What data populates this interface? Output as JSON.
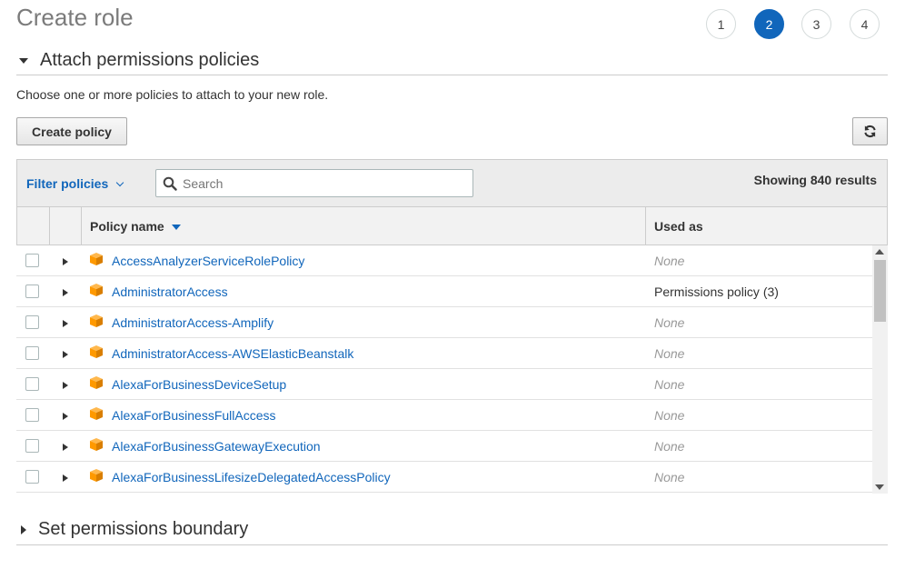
{
  "page": {
    "title": "Create role"
  },
  "steps": [
    "1",
    "2",
    "3",
    "4"
  ],
  "active_step": "2",
  "attach": {
    "heading": "Attach permissions policies",
    "description": "Choose one or more policies to attach to your new role.",
    "create_policy_label": "Create policy",
    "refresh_icon": "refresh-icon"
  },
  "filter": {
    "label": "Filter policies",
    "search_placeholder": "Search",
    "showing": "Showing 840 results"
  },
  "table": {
    "columns": {
      "name": "Policy name",
      "used": "Used as"
    },
    "rows": [
      {
        "name": "AccessAnalyzerServiceRolePolicy",
        "used": "None"
      },
      {
        "name": "AdministratorAccess",
        "used": "Permissions policy (3)"
      },
      {
        "name": "AdministratorAccess-Amplify",
        "used": "None"
      },
      {
        "name": "AdministratorAccess-AWSElasticBeanstalk",
        "used": "None"
      },
      {
        "name": "AlexaForBusinessDeviceSetup",
        "used": "None"
      },
      {
        "name": "AlexaForBusinessFullAccess",
        "used": "None"
      },
      {
        "name": "AlexaForBusinessGatewayExecution",
        "used": "None"
      },
      {
        "name": "AlexaForBusinessLifesizeDelegatedAccessPolicy",
        "used": "None"
      }
    ]
  },
  "boundary": {
    "heading": "Set permissions boundary"
  },
  "colors": {
    "accent": "#1166bb",
    "policy_icon": "#f90"
  }
}
